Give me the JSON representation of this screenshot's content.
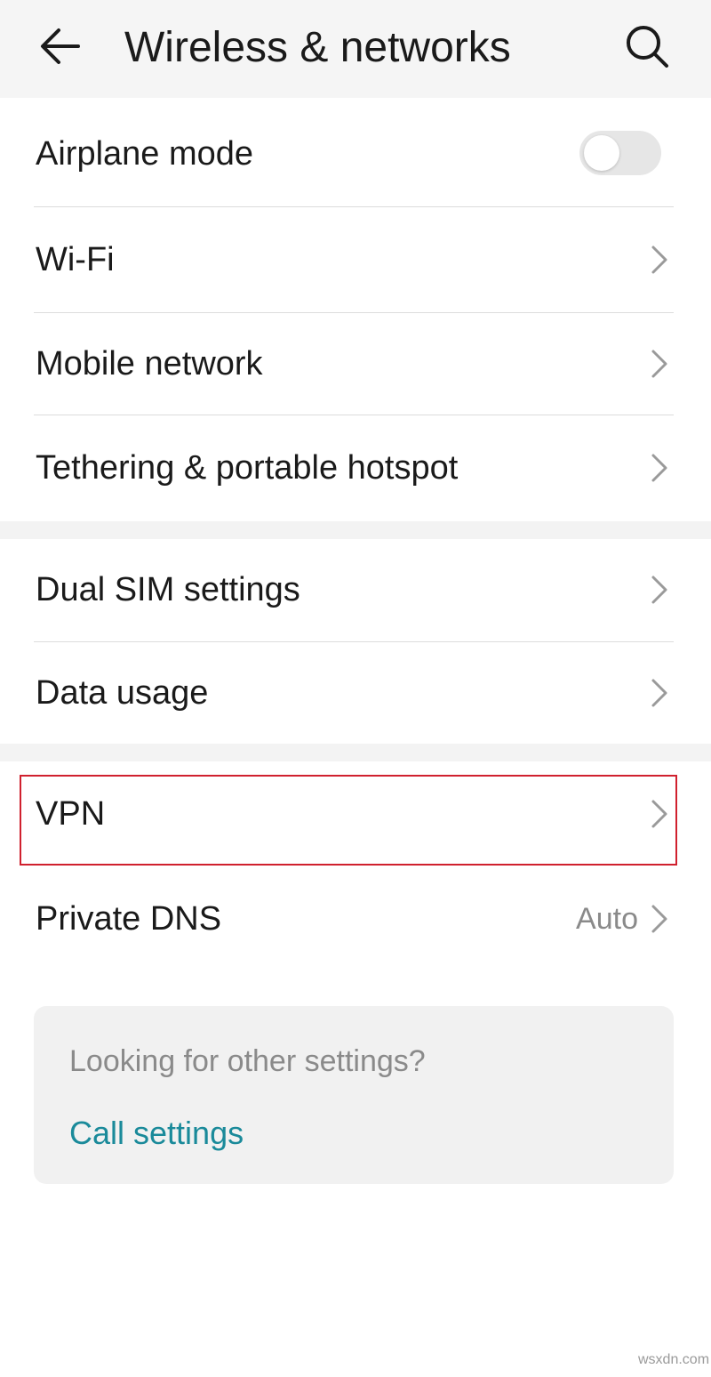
{
  "header": {
    "title": "Wireless & networks",
    "back_icon": "arrow-left-icon",
    "search_icon": "search-icon"
  },
  "settings": {
    "airplane_mode": {
      "label": "Airplane mode",
      "enabled": false
    },
    "wifi": {
      "label": "Wi-Fi"
    },
    "mobile_network": {
      "label": "Mobile network"
    },
    "tethering": {
      "label": "Tethering & portable hotspot"
    },
    "dual_sim": {
      "label": "Dual SIM settings"
    },
    "data_usage": {
      "label": "Data usage"
    },
    "vpn": {
      "label": "VPN",
      "highlighted": true
    },
    "private_dns": {
      "label": "Private DNS",
      "value": "Auto"
    }
  },
  "card": {
    "hint": "Looking for other settings?",
    "link": "Call settings"
  },
  "watermark": "wsxdn.com",
  "colors": {
    "highlight_border": "#d0202e",
    "link": "#1a8a9a",
    "secondary_text": "#8a8a8a"
  }
}
